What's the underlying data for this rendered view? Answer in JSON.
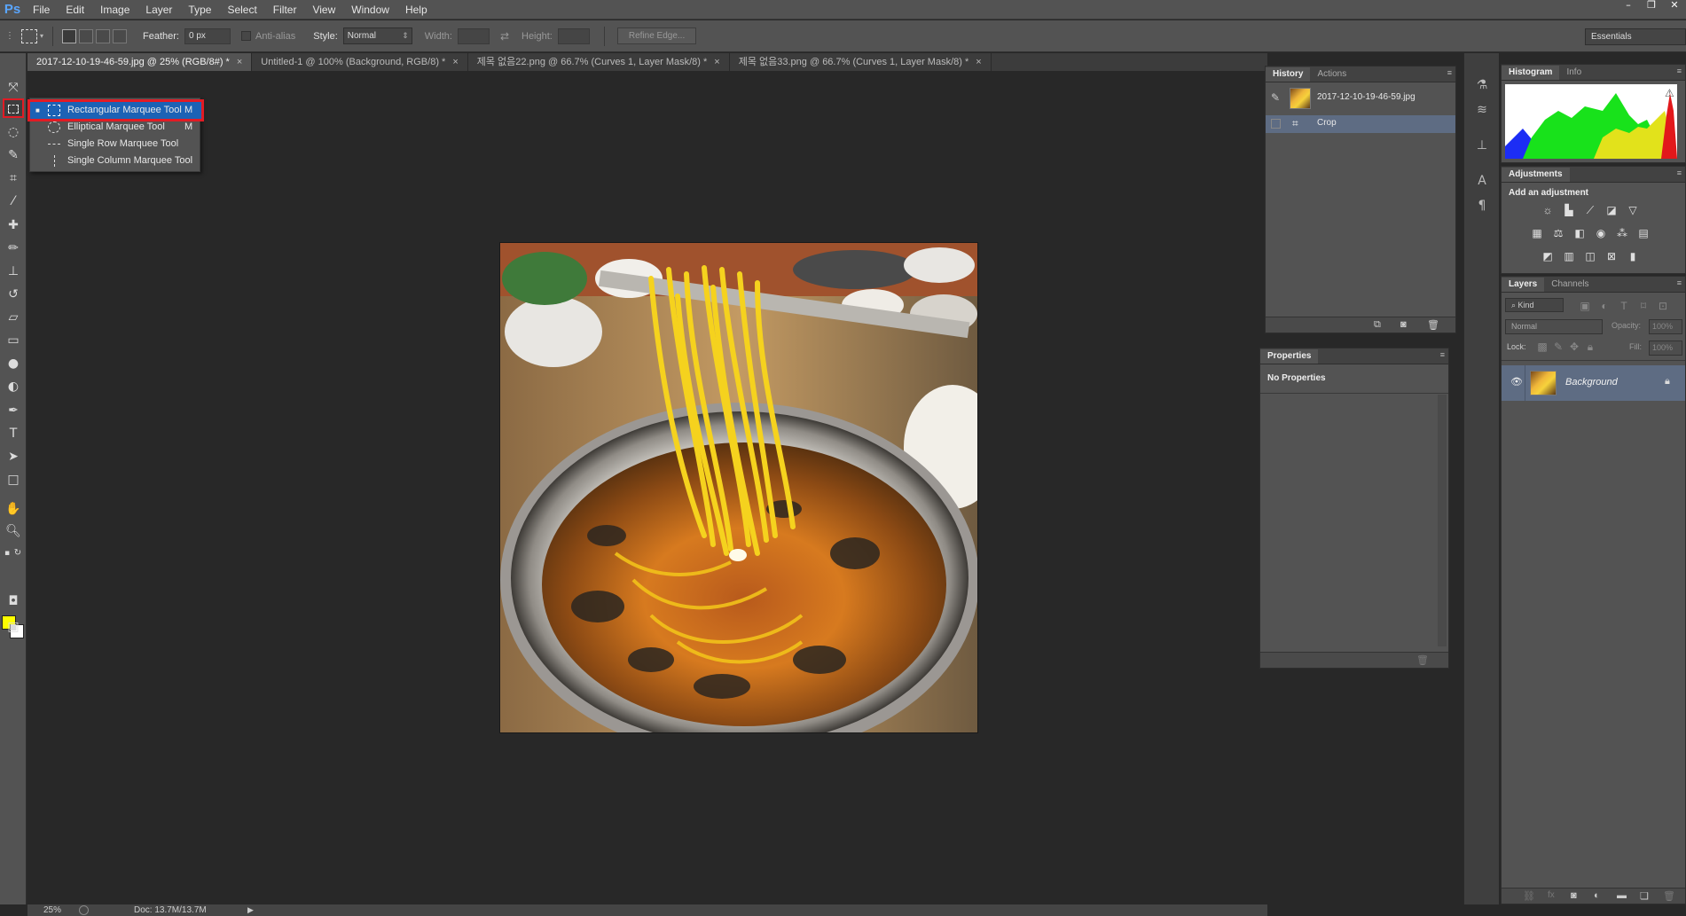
{
  "app": {
    "logo": "Ps"
  },
  "menu": [
    "File",
    "Edit",
    "Image",
    "Layer",
    "Type",
    "Select",
    "Filter",
    "View",
    "Window",
    "Help"
  ],
  "window_controls": [
    "–",
    "❐",
    "✕"
  ],
  "options": {
    "feather_label": "Feather:",
    "feather_value": "0 px",
    "antialias_label": "Anti-alias",
    "style_label": "Style:",
    "style_value": "Normal",
    "width_label": "Width:",
    "height_label": "Height:",
    "refine_edge": "Refine Edge...",
    "workspace": "Essentials"
  },
  "tabs": [
    {
      "label": "2017-12-10-19-46-59.jpg @ 25% (RGB/8#) *",
      "active": true
    },
    {
      "label": "Untitled-1 @ 100% (Background, RGB/8) *",
      "active": false
    },
    {
      "label": "제목 없음22.png @ 66.7% (Curves 1, Layer Mask/8) *",
      "active": false
    },
    {
      "label": "제목 없음33.png @ 66.7% (Curves 1, Layer Mask/8) *",
      "active": false
    }
  ],
  "tab_close": "×",
  "flyout": {
    "items": [
      {
        "label": "Rectangular Marquee Tool",
        "key": "M"
      },
      {
        "label": "Elliptical Marquee Tool",
        "key": "M"
      },
      {
        "label": "Single Row Marquee Tool",
        "key": ""
      },
      {
        "label": "Single Column Marquee Tool",
        "key": ""
      }
    ]
  },
  "status": {
    "zoom": "25%",
    "doc": "Doc: 13.7M/13.7M"
  },
  "history": {
    "tabs": [
      "History",
      "Actions"
    ],
    "snapshot": "2017-12-10-19-46-59.jpg",
    "steps": [
      "Crop"
    ]
  },
  "properties": {
    "tab": "Properties",
    "message": "No Properties"
  },
  "histogram": {
    "tabs": [
      "Histogram",
      "Info"
    ]
  },
  "adjustments": {
    "tab": "Adjustments",
    "title": "Add an adjustment"
  },
  "layers": {
    "tabs": [
      "Layers",
      "Channels"
    ],
    "kind": "Kind",
    "blend": "Normal",
    "opacity_label": "Opacity:",
    "opacity_value": "100%",
    "lock_label": "Lock:",
    "fill_label": "Fill:",
    "fill_value": "100%",
    "items": [
      {
        "name": "Background"
      }
    ]
  },
  "colors": {
    "foreground": "#ffff00",
    "background": "#ffffff",
    "highlight": "#e21b24",
    "selection": "#1c62b5"
  }
}
